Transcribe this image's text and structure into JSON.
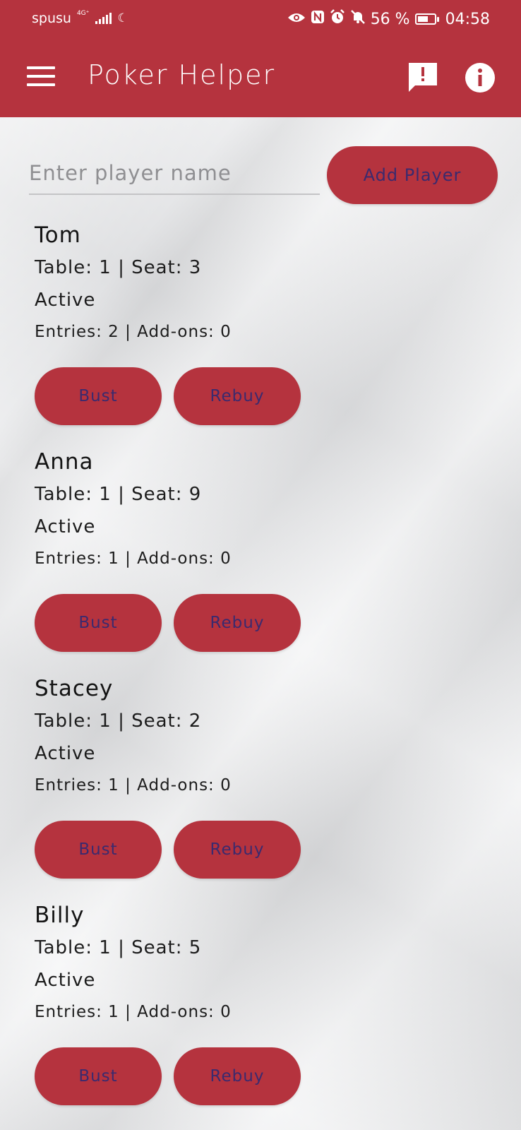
{
  "status_bar": {
    "carrier": "spusu",
    "network": "4G⁺",
    "battery": "56 %",
    "time": "04:58"
  },
  "app_bar": {
    "title": "Poker Helper"
  },
  "add_player": {
    "placeholder": "Enter player name",
    "value": "",
    "button_label": "Add Player"
  },
  "players": [
    {
      "name": "Tom",
      "table_seat": "Table: 1 | Seat: 3",
      "status": "Active",
      "entries": "Entries: 2 | Add-ons: 0",
      "bust_label": "Bust",
      "rebuy_label": "Rebuy"
    },
    {
      "name": "Anna",
      "table_seat": "Table: 1 | Seat: 9",
      "status": "Active",
      "entries": "Entries: 1 | Add-ons: 0",
      "bust_label": "Bust",
      "rebuy_label": "Rebuy"
    },
    {
      "name": "Stacey",
      "table_seat": "Table: 1 | Seat: 2",
      "status": "Active",
      "entries": "Entries: 1 | Add-ons: 0",
      "bust_label": "Bust",
      "rebuy_label": "Rebuy"
    },
    {
      "name": "Billy",
      "table_seat": "Table: 1 | Seat: 5",
      "status": "Active",
      "entries": "Entries: 1 | Add-ons: 0",
      "bust_label": "Bust",
      "rebuy_label": "Rebuy"
    }
  ],
  "colors": {
    "primary": "#b5333e",
    "button_text": "#3b2a6e",
    "background": "#e8e9eb"
  },
  "icons": {
    "menu": "hamburger-menu-icon",
    "report": "report-feedback-icon",
    "info": "info-icon"
  }
}
